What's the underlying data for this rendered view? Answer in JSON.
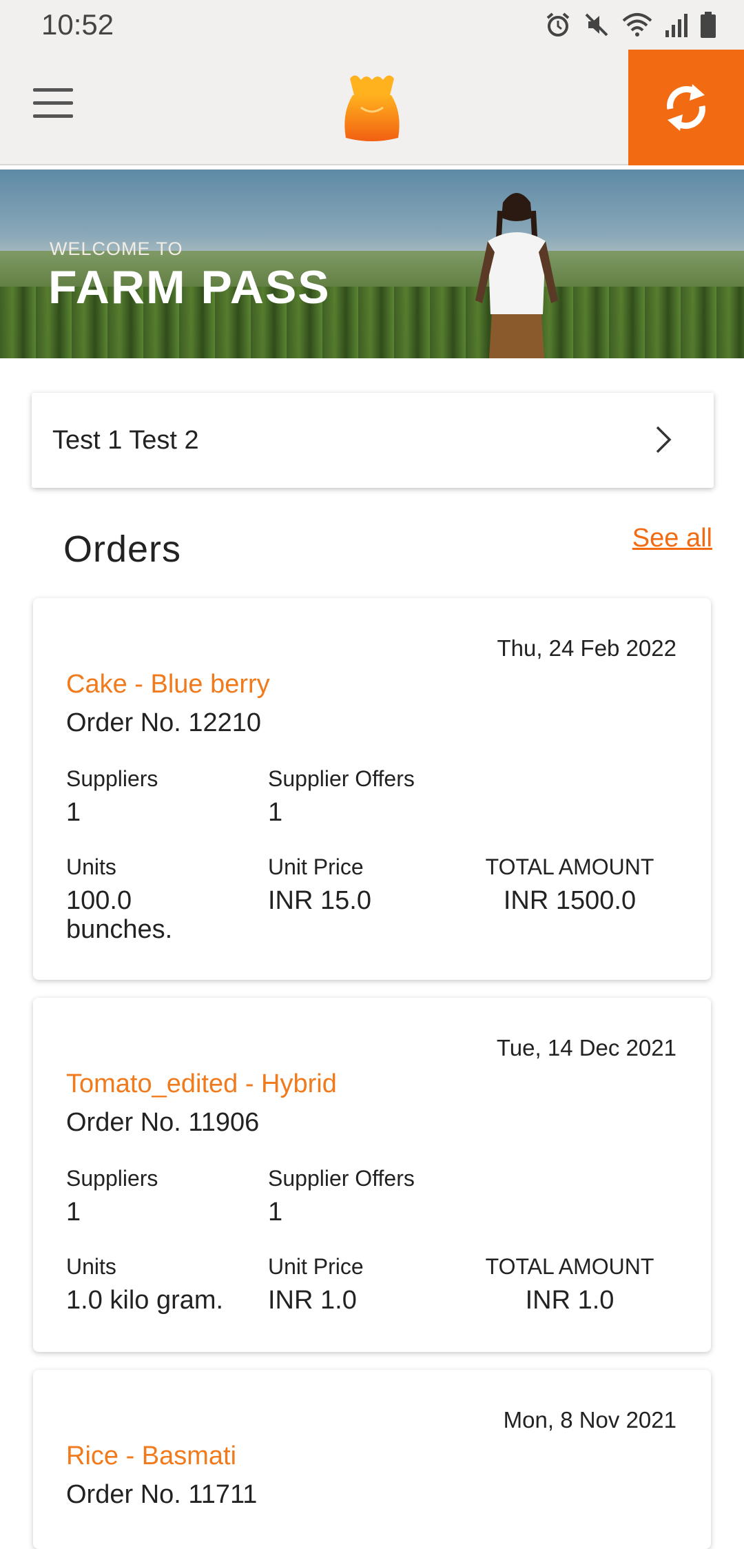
{
  "status_bar": {
    "time": "10:52",
    "icons": [
      "alarm-icon",
      "mute-icon",
      "wifi-icon",
      "signal-icon",
      "battery-icon"
    ]
  },
  "app_bar": {
    "menu_icon": "hamburger-menu-icon",
    "logo_icon": "produce-basket-logo",
    "sync_icon": "sync-icon",
    "accent_color": "#f26b12"
  },
  "banner": {
    "welcome_line": "WELCOME TO",
    "app_name": "FARM PASS"
  },
  "profile": {
    "name": "Test 1  Test 2"
  },
  "orders_section": {
    "title": "Orders",
    "see_all_label": "See all",
    "orders": [
      {
        "date": "Thu, 24 Feb 2022",
        "product": "Cake - Blue berry",
        "order_no": "Order No. 12210",
        "suppliers_label": "Suppliers",
        "suppliers": "1",
        "offers_label": "Supplier Offers",
        "offers": "1",
        "units_label": "Units",
        "units": "100.0 bunches.",
        "unit_price_label": "Unit Price",
        "unit_price": "INR 15.0",
        "total_label": "TOTAL AMOUNT",
        "total": "INR 1500.0"
      },
      {
        "date": "Tue, 14 Dec 2021",
        "product": "Tomato_edited - Hybrid",
        "order_no": "Order No. 11906",
        "suppliers_label": "Suppliers",
        "suppliers": "1",
        "offers_label": "Supplier Offers",
        "offers": "1",
        "units_label": "Units",
        "units": "1.0 kilo gram.",
        "unit_price_label": "Unit Price",
        "unit_price": "INR 1.0",
        "total_label": "TOTAL AMOUNT",
        "total": "INR 1.0"
      },
      {
        "date": "Mon, 8 Nov 2021",
        "product": "Rice - Basmati",
        "order_no": "Order No. 11711"
      }
    ]
  }
}
